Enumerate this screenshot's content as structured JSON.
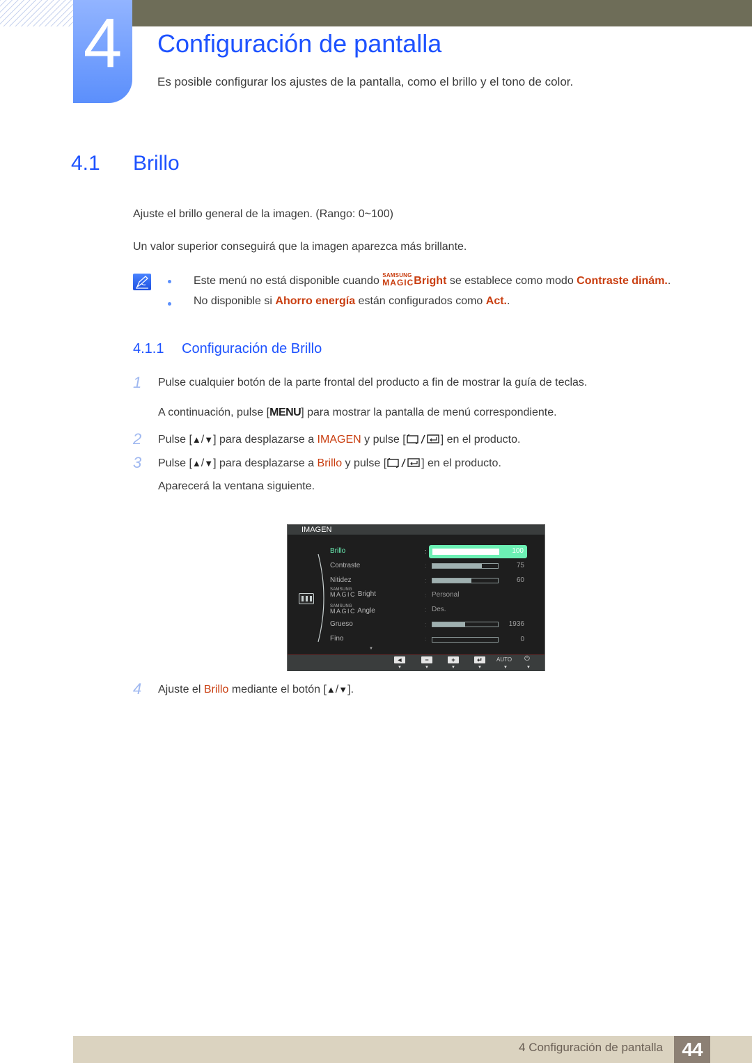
{
  "chapter": {
    "number": "4",
    "title": "Configuración de pantalla",
    "intro": "Es posible configurar los ajustes de la pantalla, como el brillo y el tono de color."
  },
  "section": {
    "number": "4.1",
    "title": "Brillo",
    "paragraphs": [
      "Ajuste el brillo general de la imagen. (Rango: 0~100)",
      "Un valor superior conseguirá que la imagen aparezca más brillante."
    ]
  },
  "notes": {
    "icon": "pencil-note-icon",
    "note1": {
      "pre": "Este menú no está disponible cuando ",
      "magic_top": "SAMSUNG",
      "magic_bottom": "MAGIC",
      "magic_word": "Bright",
      "mid": " se establece como modo ",
      "highlight": "Contraste dinám.",
      "post": "."
    },
    "note2": {
      "pre": "No disponible si ",
      "highlight1": "Ahorro energía",
      "mid": " están configurados como ",
      "highlight2": "Act.",
      "post": "."
    }
  },
  "subsection": {
    "number": "4.1.1",
    "title": "Configuración de Brillo"
  },
  "steps": {
    "s1": {
      "num": "1",
      "text": "Pulse cualquier botón de la parte frontal del producto a fin de mostrar la guía de teclas."
    },
    "s1b": {
      "pre": "A continuación, pulse [",
      "key": "MENU",
      "post": "] para mostrar la pantalla de menú correspondiente."
    },
    "s2": {
      "num": "2",
      "pre": "Pulse [",
      "up": "▲",
      "slash": "/",
      "down": "▼",
      "mid": "] para desplazarse a ",
      "highlight": "IMAGEN",
      "mid2": " y pulse [",
      "post": "] en el producto."
    },
    "s3": {
      "num": "3",
      "pre": "Pulse [",
      "up": "▲",
      "slash": "/",
      "down": "▼",
      "mid": "] para desplazarse a ",
      "highlight": "Brillo",
      "mid2": " y pulse [",
      "post": "] en el producto."
    },
    "s3b": {
      "text": "Aparecerá la ventana siguiente."
    },
    "s4": {
      "num": "4",
      "pre": "Ajuste el ",
      "highlight": "Brillo",
      "mid": " mediante el botón [",
      "up": "▲",
      "slash": "/",
      "down": "▼",
      "post": "]."
    }
  },
  "osd": {
    "title": "IMAGEN",
    "colon": ":",
    "items": [
      {
        "label": "Brillo",
        "type": "bar",
        "value": "100",
        "fill_pct": 100,
        "active": true
      },
      {
        "label": "Contraste",
        "type": "bar",
        "value": "75",
        "fill_pct": 75
      },
      {
        "label": "Nitidez",
        "type": "bar",
        "value": "60",
        "fill_pct": 60
      },
      {
        "label_top": "SAMSUNG",
        "label_bottom": "MAGIC",
        "label": "Bright",
        "type": "text",
        "value": "Personal"
      },
      {
        "label_top": "SAMSUNG",
        "label_bottom": "MAGIC",
        "label": "Angle",
        "type": "text",
        "value": "Des."
      },
      {
        "label": "Grueso",
        "type": "bar",
        "value": "1936",
        "fill_pct": 50
      },
      {
        "label": "Fino",
        "type": "bar",
        "value": "0",
        "fill_pct": 0
      }
    ],
    "more": "▼",
    "buttons": [
      "◄",
      "−",
      "+",
      "↵",
      "AUTO",
      "⏻"
    ],
    "arrow": "▼"
  },
  "footer": {
    "text": "4 Configuración de pantalla",
    "page": "44"
  },
  "colors": {
    "heading_blue": "#1d52ff",
    "highlight_orange": "#c93e10",
    "osd_active": "#6cf0b4",
    "top_bar": "#6e6d58",
    "footer_bar": "#dbd3c0",
    "page_box": "#8c8074"
  }
}
